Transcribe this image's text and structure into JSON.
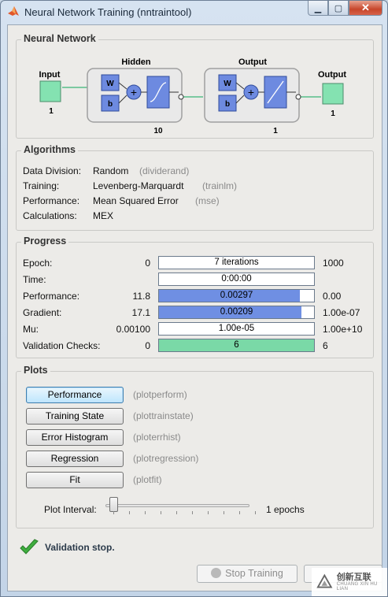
{
  "window": {
    "title": "Neural Network Training (nntraintool)"
  },
  "network": {
    "section_title": "Neural Network",
    "input_label": "Input",
    "input_size": "1",
    "hidden_label": "Hidden",
    "hidden_size": "10",
    "output_layer_label": "Output",
    "output_layer_size": "1",
    "output_label": "Output",
    "output_size": "1",
    "w_label": "W",
    "b_label": "b",
    "sum_symbol": "+"
  },
  "algorithms": {
    "section_title": "Algorithms",
    "rows": [
      {
        "label": "Data Division:",
        "value": "Random",
        "fn": "(dividerand)"
      },
      {
        "label": "Training:",
        "value": "Levenberg-Marquardt",
        "fn": "(trainlm)"
      },
      {
        "label": "Performance:",
        "value": "Mean Squared Error",
        "fn": "(mse)"
      },
      {
        "label": "Calculations:",
        "value": "MEX",
        "fn": ""
      }
    ]
  },
  "progress": {
    "section_title": "Progress",
    "rows": [
      {
        "label": "Epoch:",
        "start": "0",
        "bar_text": "7 iterations",
        "end": "1000",
        "fill": 0.0,
        "color": "#6f8fe3"
      },
      {
        "label": "Time:",
        "start": "",
        "bar_text": "0:00:00",
        "end": "",
        "fill": 0.0,
        "color": "#6f8fe3"
      },
      {
        "label": "Performance:",
        "start": "11.8",
        "bar_text": "0.00297",
        "end": "0.00",
        "fill": 0.91,
        "color": "#6f8fe3"
      },
      {
        "label": "Gradient:",
        "start": "17.1",
        "bar_text": "0.00209",
        "end": "1.00e-07",
        "fill": 0.92,
        "color": "#6f8fe3"
      },
      {
        "label": "Mu:",
        "start": "0.00100",
        "bar_text": "1.00e-05",
        "end": "1.00e+10",
        "fill": 0.0,
        "color": "#6f8fe3"
      },
      {
        "label": "Validation Checks:",
        "start": "0",
        "bar_text": "6",
        "end": "6",
        "fill": 1.0,
        "color": "#7ad9a7"
      }
    ]
  },
  "plots": {
    "section_title": "Plots",
    "buttons": [
      {
        "label": "Performance",
        "fn": "(plotperform)"
      },
      {
        "label": "Training State",
        "fn": "(plottrainstate)"
      },
      {
        "label": "Error Histogram",
        "fn": "(ploterrhist)"
      },
      {
        "label": "Regression",
        "fn": "(plotregression)"
      },
      {
        "label": "Fit",
        "fn": "(plotfit)"
      }
    ],
    "interval_label": "Plot Interval:",
    "interval_value": "1 epochs",
    "interval_fill": 0.0
  },
  "status": {
    "text": "Validation stop."
  },
  "footer": {
    "stop_label": "Stop Training"
  },
  "watermark": {
    "text": "创新互联",
    "sub": "CHUANG XIN HU LIAN"
  },
  "colors": {
    "layer_fill": "#6d8ae0",
    "io_fill": "#84e2b1",
    "bar_blue": "#6f8fe3",
    "bar_green": "#7ad9a7"
  }
}
